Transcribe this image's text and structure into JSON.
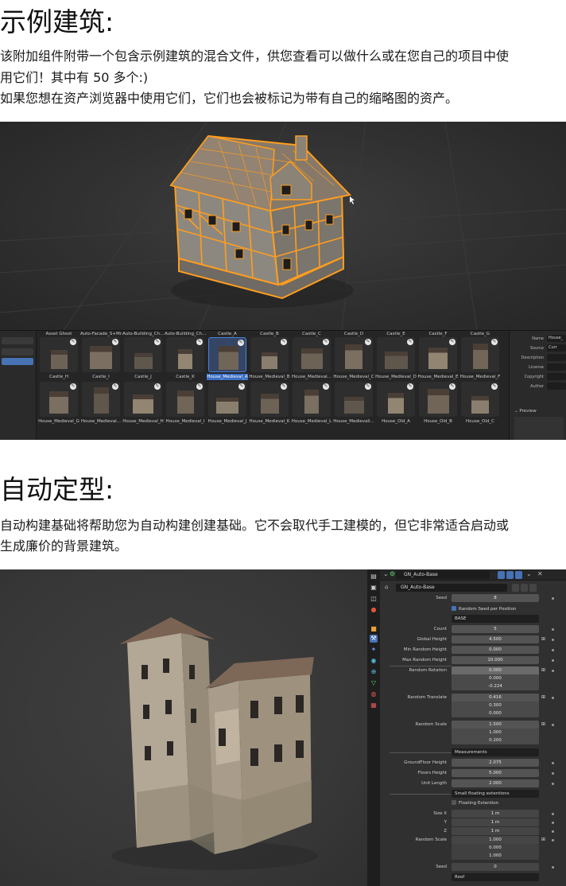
{
  "section1": {
    "title": "示例建筑:",
    "line1": "该附加组件附带一个包含示例建筑的混合文件，供您查看可以做什么或在您自己的项目中使",
    "line2": "用它们！其中有 50 多个:)",
    "line3": "如果您想在资产浏览器中使用它们，它们也会被标记为带有自己的缩略图的资产。"
  },
  "asset_browser": {
    "top_row_partial": [
      "Asset Ghost",
      "Auto-Facade_S+Mn",
      "Auto-Building_Ch...",
      "Auto-Building_Ch...",
      "Castle_A",
      "Castle_B",
      "Castle_C",
      "Castle_D",
      "Castle_E",
      "Castle_F",
      "Castle_G"
    ],
    "row1": [
      "Castle_H",
      "Castle_I",
      "Castle_J",
      "Castle_K",
      "House_Medieval_A",
      "House_Medieval_B",
      "House_Medieval...",
      "House_Medieval_C",
      "House_Medieval_D",
      "House_Medieval_E",
      "House_Medieval_F"
    ],
    "row2": [
      "House_Medieval_G",
      "House_Medieval...",
      "House_Medieval_H",
      "House_Medieval_I",
      "House_Medieval_J",
      "House_Medieval_K",
      "House_Medieval_L",
      "House_Medievali...",
      "House_Old_A",
      "House_Old_B",
      "House_Old_C"
    ],
    "selected_index": 4,
    "meta": {
      "name_label": "Name",
      "name_value": "House_",
      "source_label": "Source",
      "source_value": "Curr",
      "description_label": "Description",
      "license_label": "License",
      "copyright_label": "Copyright",
      "author_label": "Author",
      "preview_label": "Preview"
    },
    "accent": "#3b6fc4"
  },
  "section2": {
    "title": "自动定型:",
    "line1": "自动构建基础将帮助您为自动构建创建基础。它不会取代手工建模的，但它非常适合启动或",
    "line2": "生成廉价的背景建筑。"
  },
  "props": {
    "modifier_name": "GN_Auto-Base",
    "nodegroup_name": "GN_Auto-Base",
    "seed_label": "Seed",
    "seed_value": "8",
    "random_seed_label": "Random Seed per Position",
    "base_section": "BASE",
    "count_label": "Count",
    "count_value": "5",
    "global_height_label": "Global Height",
    "global_height_value": "4.500",
    "min_random_height_label": "Min Random Height",
    "min_random_height_value": "0.000",
    "max_random_height_label": "Max Random Height",
    "max_random_height_value": "10.000",
    "random_rotation_label": "Random Rotation",
    "random_rotation_values": [
      "0.000",
      "0.000",
      "-0.224"
    ],
    "random_translate_label": "Random Translate",
    "random_translate_values": [
      "0.416",
      "0.300",
      "0.000"
    ],
    "random_scale_label": "Random Scale",
    "random_scale_values": [
      "1.500",
      "1.000",
      "0.200"
    ],
    "measurements_section": "Measurements",
    "groundfloor_label": "GroundFloor Height",
    "groundfloor_value": "2.075",
    "floors_label": "Floors Height",
    "floors_value": "5.000",
    "unit_label": "Unit Length",
    "unit_value": "2.000",
    "small_floating_section": "Small floating extentions",
    "floating_ext_label": "Floating Extention",
    "size_x_label": "Size X",
    "size_x_value": "1 m",
    "size_y_label": "Y",
    "size_y_value": "1 m",
    "size_z_label": "Z",
    "size_z_value": "1 m",
    "random_scale2_label": "Random Scale",
    "random_scale2_values": [
      "1.000",
      "0.000",
      "1.000"
    ],
    "seed2_label": "Seed",
    "seed2_value": "0",
    "roof_section": "Roof",
    "accent": "#4772b3"
  }
}
